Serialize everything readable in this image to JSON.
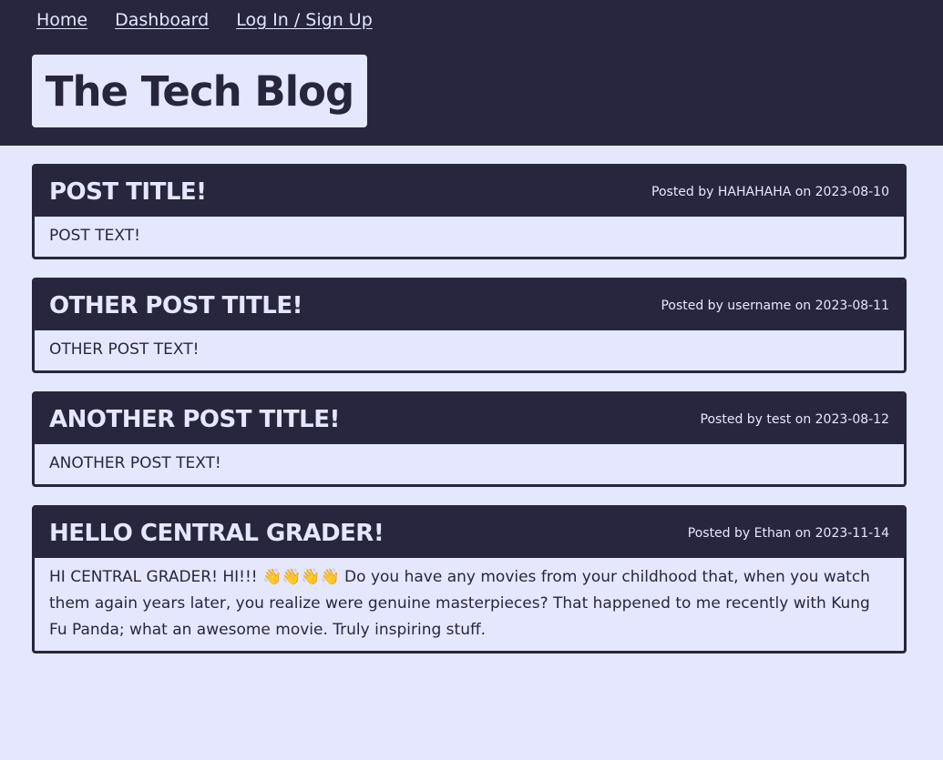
{
  "nav": {
    "home": "Home",
    "dashboard": "Dashboard",
    "login": "Log In / Sign Up"
  },
  "brand": {
    "title": "The Tech Blog"
  },
  "posts": [
    {
      "title": "POST TITLE!",
      "meta": "Posted by HAHAHAHA on 2023-08-10",
      "body": "POST TEXT!"
    },
    {
      "title": "OTHER POST TITLE!",
      "meta": "Posted by username on 2023-08-11",
      "body": "OTHER POST TEXT!"
    },
    {
      "title": "ANOTHER POST TITLE!",
      "meta": "Posted by test on 2023-08-12",
      "body": "ANOTHER POST TEXT!"
    },
    {
      "title": "HELLO CENTRAL GRADER!",
      "meta": "Posted by Ethan on 2023-11-14",
      "body": "HI CENTRAL GRADER! HI!!! 👋👋👋👋 Do you have any movies from your childhood that, when you watch them again years later, you realize were genuine masterpieces? That happened to me recently with Kung Fu Panda; what an awesome movie. Truly inspiring stuff."
    }
  ],
  "colors": {
    "dark": "#28263f",
    "light": "#e5e7ff"
  }
}
